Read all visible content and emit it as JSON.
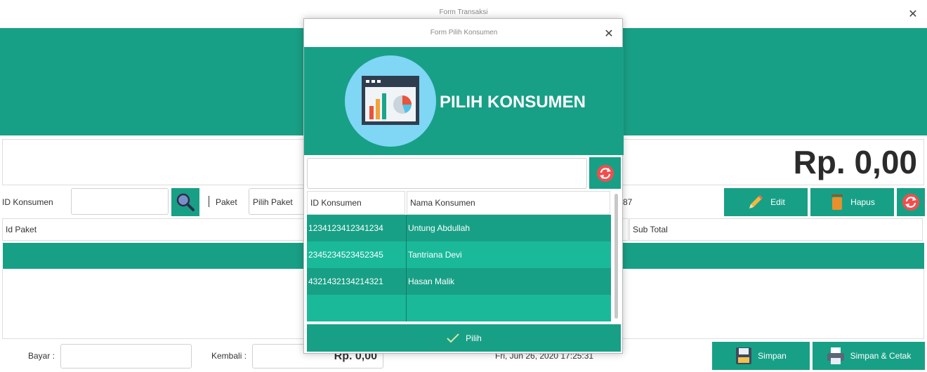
{
  "main_window": {
    "title": "Form Transaksi",
    "total_display": "Rp. 0,00",
    "id_konsumen_label": "ID Konsumen",
    "paket_label": "Paket",
    "pilih_paket_label": "Pilih Paket",
    "partial_value": "87",
    "edit_label": "Edit",
    "hapus_label": "Hapus",
    "table_headers": {
      "id_paket": "Id Paket",
      "sub_total": "Sub Total"
    },
    "bayar_label": "Bayar :",
    "kembali_label": "Kembali :",
    "kembali_value": "Rp. 0,00",
    "datetime": "Fri, Jun 26, 2020 17:25:31",
    "simpan_label": "Simpan",
    "simpan_cetak_label": "Simpan & Cetak"
  },
  "dialog": {
    "title": "Form Pilih Konsumen",
    "heading": "PILIH KONSUMEN",
    "search_value": "",
    "columns": [
      "ID Konsumen",
      "Nama Konsumen"
    ],
    "rows": [
      {
        "id": "1234123412341234",
        "nama": "Untung Abdullah"
      },
      {
        "id": "2345234523452345",
        "nama": "Tantriana Devi"
      },
      {
        "id": "4321432134214321",
        "nama": "Hasan Malik"
      }
    ],
    "pilih_label": "Pilih"
  },
  "colors": {
    "teal": "#18a086",
    "teal_light": "#1ab99a",
    "accent_red": "#f04e4e"
  }
}
